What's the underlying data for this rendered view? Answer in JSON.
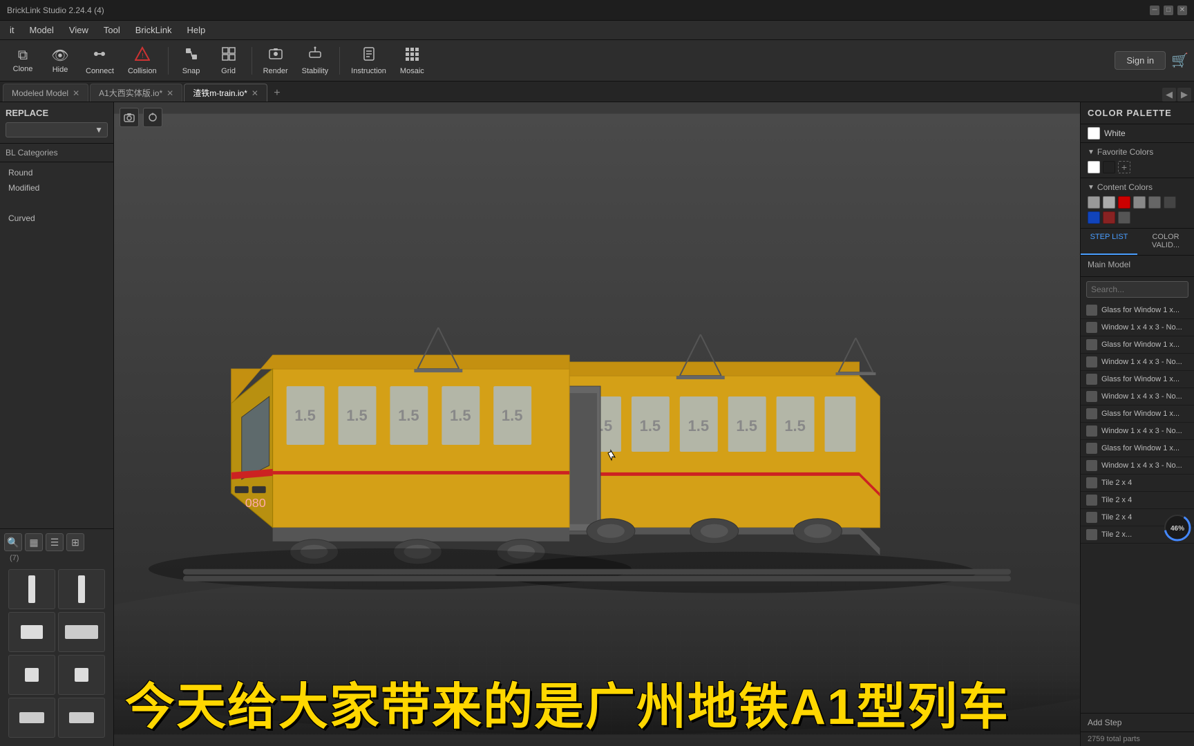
{
  "titlebar": {
    "title": "BrickLink Studio 2.24.4 (4)",
    "controls": [
      "minimize",
      "maximize",
      "close"
    ]
  },
  "menubar": {
    "items": [
      "it",
      "Model",
      "View",
      "Tool",
      "BrickLink",
      "Help"
    ]
  },
  "toolbar": {
    "buttons": [
      {
        "id": "clone",
        "label": "Clone",
        "icon": "⧉"
      },
      {
        "id": "hide",
        "label": "Hide",
        "icon": "👁"
      },
      {
        "id": "connect",
        "label": "Connect",
        "icon": "🔗"
      },
      {
        "id": "collision",
        "label": "Collision",
        "icon": "⚠"
      },
      {
        "id": "snap",
        "label": "Snap",
        "icon": "🧲"
      },
      {
        "id": "grid",
        "label": "Grid",
        "icon": "⊞"
      },
      {
        "id": "render",
        "label": "Render",
        "icon": "📷"
      },
      {
        "id": "stability",
        "label": "Stability",
        "icon": "⚖"
      },
      {
        "id": "instruction",
        "label": "Instruction",
        "icon": "📋"
      },
      {
        "id": "mosaic",
        "label": "Mosaic",
        "icon": "▦"
      }
    ],
    "sign_in_label": "Sign in",
    "cart_icon": "🛒"
  },
  "tabs": {
    "items": [
      {
        "id": "modeled-model",
        "label": "Modeled Model",
        "active": false,
        "closeable": true
      },
      {
        "id": "a1-model",
        "label": "A1大西实体版.io*",
        "active": false,
        "closeable": true
      },
      {
        "id": "train-model",
        "label": "渣铁m-train.io*",
        "active": true,
        "closeable": true
      }
    ],
    "add_label": "+"
  },
  "sidebar": {
    "replace_label": "REPLACE",
    "dropdown_placeholder": "",
    "bl_categories_label": "BL Categories",
    "categories": [
      {
        "label": "Round"
      },
      {
        "label": "Modified"
      },
      {
        "label": ""
      },
      {
        "label": "Curved"
      }
    ],
    "result_count": "(7)",
    "parts": [
      {
        "shape": "thin"
      },
      {
        "shape": "thin"
      },
      {
        "shape": "brick1"
      },
      {
        "shape": "brick2"
      },
      {
        "shape": "small-sq"
      },
      {
        "shape": "small-sq"
      },
      {
        "shape": "rect"
      },
      {
        "shape": "rect"
      }
    ]
  },
  "viewport": {
    "camera_icon": "📷",
    "rotate_icon": "↻",
    "subtitle": "今天给大家带来的是广州地铁A1型列车"
  },
  "right_panel": {
    "title": "COLOR PALETTE",
    "white_color_label": "White",
    "favorite_colors_label": "Favorite Colors",
    "content_colors_label": "Content Colors",
    "swatches": {
      "favorite": [
        "#ffffff",
        "#222222"
      ],
      "content": [
        "#999999",
        "#aaaaaa",
        "#cc0000",
        "#888888",
        "#666666",
        "#444444",
        "#1144bb",
        "#882222",
        "#555555"
      ]
    },
    "tabs": [
      {
        "id": "step-list",
        "label": "STEP LIST",
        "active": true
      },
      {
        "id": "color-valid",
        "label": "COLOR VALID...",
        "active": false
      }
    ],
    "model_label": "Main Model",
    "search_placeholder": "Search...",
    "parts_list": [
      {
        "icon": true,
        "text": "Glass for Window 1 x..."
      },
      {
        "icon": true,
        "text": "Window 1 x 4 x 3 - No..."
      },
      {
        "icon": true,
        "text": "Glass for Window 1 x..."
      },
      {
        "icon": true,
        "text": "Window 1 x 4 x 3 - No..."
      },
      {
        "icon": true,
        "text": "Glass for Window 1 x..."
      },
      {
        "icon": true,
        "text": "Window 1 x 4 x 3 - No..."
      },
      {
        "icon": true,
        "text": "Glass for Window 1 x..."
      },
      {
        "icon": true,
        "text": "Window 1 x 4 x 3 - No..."
      },
      {
        "icon": true,
        "text": "Glass for Window 1 x..."
      },
      {
        "icon": true,
        "text": "Window 1 x 4 x 3 - No..."
      },
      {
        "icon": true,
        "text": "Tile 2 x 4"
      },
      {
        "icon": true,
        "text": "Tile 2 x 4"
      },
      {
        "icon": true,
        "text": "Tile 2 x 4"
      },
      {
        "icon": true,
        "text": "Tile 2 x..."
      }
    ],
    "progress_label": "46%",
    "add_step_label": "Add Step",
    "total_parts_label": "2759 total parts"
  }
}
